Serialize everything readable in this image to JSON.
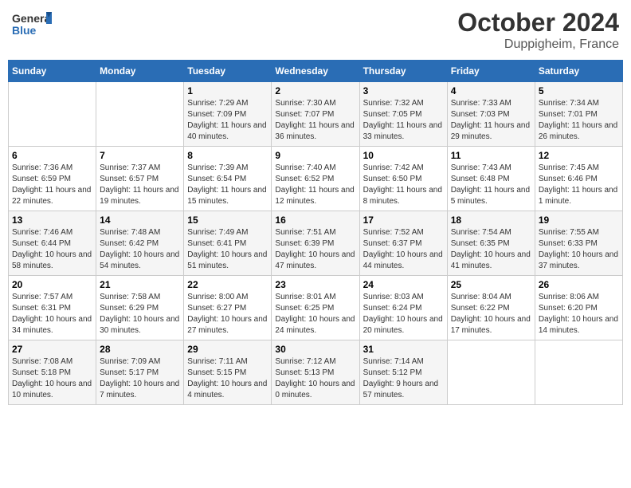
{
  "header": {
    "logo_general": "General",
    "logo_blue": "Blue",
    "month": "October 2024",
    "location": "Duppigheim, France"
  },
  "calendar": {
    "days_of_week": [
      "Sunday",
      "Monday",
      "Tuesday",
      "Wednesday",
      "Thursday",
      "Friday",
      "Saturday"
    ],
    "weeks": [
      [
        {
          "day": null,
          "sunrise": null,
          "sunset": null,
          "daylight": null
        },
        {
          "day": null,
          "sunrise": null,
          "sunset": null,
          "daylight": null
        },
        {
          "day": 1,
          "sunrise": "Sunrise: 7:29 AM",
          "sunset": "Sunset: 7:09 PM",
          "daylight": "Daylight: 11 hours and 40 minutes."
        },
        {
          "day": 2,
          "sunrise": "Sunrise: 7:30 AM",
          "sunset": "Sunset: 7:07 PM",
          "daylight": "Daylight: 11 hours and 36 minutes."
        },
        {
          "day": 3,
          "sunrise": "Sunrise: 7:32 AM",
          "sunset": "Sunset: 7:05 PM",
          "daylight": "Daylight: 11 hours and 33 minutes."
        },
        {
          "day": 4,
          "sunrise": "Sunrise: 7:33 AM",
          "sunset": "Sunset: 7:03 PM",
          "daylight": "Daylight: 11 hours and 29 minutes."
        },
        {
          "day": 5,
          "sunrise": "Sunrise: 7:34 AM",
          "sunset": "Sunset: 7:01 PM",
          "daylight": "Daylight: 11 hours and 26 minutes."
        }
      ],
      [
        {
          "day": 6,
          "sunrise": "Sunrise: 7:36 AM",
          "sunset": "Sunset: 6:59 PM",
          "daylight": "Daylight: 11 hours and 22 minutes."
        },
        {
          "day": 7,
          "sunrise": "Sunrise: 7:37 AM",
          "sunset": "Sunset: 6:57 PM",
          "daylight": "Daylight: 11 hours and 19 minutes."
        },
        {
          "day": 8,
          "sunrise": "Sunrise: 7:39 AM",
          "sunset": "Sunset: 6:54 PM",
          "daylight": "Daylight: 11 hours and 15 minutes."
        },
        {
          "day": 9,
          "sunrise": "Sunrise: 7:40 AM",
          "sunset": "Sunset: 6:52 PM",
          "daylight": "Daylight: 11 hours and 12 minutes."
        },
        {
          "day": 10,
          "sunrise": "Sunrise: 7:42 AM",
          "sunset": "Sunset: 6:50 PM",
          "daylight": "Daylight: 11 hours and 8 minutes."
        },
        {
          "day": 11,
          "sunrise": "Sunrise: 7:43 AM",
          "sunset": "Sunset: 6:48 PM",
          "daylight": "Daylight: 11 hours and 5 minutes."
        },
        {
          "day": 12,
          "sunrise": "Sunrise: 7:45 AM",
          "sunset": "Sunset: 6:46 PM",
          "daylight": "Daylight: 11 hours and 1 minute."
        }
      ],
      [
        {
          "day": 13,
          "sunrise": "Sunrise: 7:46 AM",
          "sunset": "Sunset: 6:44 PM",
          "daylight": "Daylight: 10 hours and 58 minutes."
        },
        {
          "day": 14,
          "sunrise": "Sunrise: 7:48 AM",
          "sunset": "Sunset: 6:42 PM",
          "daylight": "Daylight: 10 hours and 54 minutes."
        },
        {
          "day": 15,
          "sunrise": "Sunrise: 7:49 AM",
          "sunset": "Sunset: 6:41 PM",
          "daylight": "Daylight: 10 hours and 51 minutes."
        },
        {
          "day": 16,
          "sunrise": "Sunrise: 7:51 AM",
          "sunset": "Sunset: 6:39 PM",
          "daylight": "Daylight: 10 hours and 47 minutes."
        },
        {
          "day": 17,
          "sunrise": "Sunrise: 7:52 AM",
          "sunset": "Sunset: 6:37 PM",
          "daylight": "Daylight: 10 hours and 44 minutes."
        },
        {
          "day": 18,
          "sunrise": "Sunrise: 7:54 AM",
          "sunset": "Sunset: 6:35 PM",
          "daylight": "Daylight: 10 hours and 41 minutes."
        },
        {
          "day": 19,
          "sunrise": "Sunrise: 7:55 AM",
          "sunset": "Sunset: 6:33 PM",
          "daylight": "Daylight: 10 hours and 37 minutes."
        }
      ],
      [
        {
          "day": 20,
          "sunrise": "Sunrise: 7:57 AM",
          "sunset": "Sunset: 6:31 PM",
          "daylight": "Daylight: 10 hours and 34 minutes."
        },
        {
          "day": 21,
          "sunrise": "Sunrise: 7:58 AM",
          "sunset": "Sunset: 6:29 PM",
          "daylight": "Daylight: 10 hours and 30 minutes."
        },
        {
          "day": 22,
          "sunrise": "Sunrise: 8:00 AM",
          "sunset": "Sunset: 6:27 PM",
          "daylight": "Daylight: 10 hours and 27 minutes."
        },
        {
          "day": 23,
          "sunrise": "Sunrise: 8:01 AM",
          "sunset": "Sunset: 6:25 PM",
          "daylight": "Daylight: 10 hours and 24 minutes."
        },
        {
          "day": 24,
          "sunrise": "Sunrise: 8:03 AM",
          "sunset": "Sunset: 6:24 PM",
          "daylight": "Daylight: 10 hours and 20 minutes."
        },
        {
          "day": 25,
          "sunrise": "Sunrise: 8:04 AM",
          "sunset": "Sunset: 6:22 PM",
          "daylight": "Daylight: 10 hours and 17 minutes."
        },
        {
          "day": 26,
          "sunrise": "Sunrise: 8:06 AM",
          "sunset": "Sunset: 6:20 PM",
          "daylight": "Daylight: 10 hours and 14 minutes."
        }
      ],
      [
        {
          "day": 27,
          "sunrise": "Sunrise: 7:08 AM",
          "sunset": "Sunset: 5:18 PM",
          "daylight": "Daylight: 10 hours and 10 minutes."
        },
        {
          "day": 28,
          "sunrise": "Sunrise: 7:09 AM",
          "sunset": "Sunset: 5:17 PM",
          "daylight": "Daylight: 10 hours and 7 minutes."
        },
        {
          "day": 29,
          "sunrise": "Sunrise: 7:11 AM",
          "sunset": "Sunset: 5:15 PM",
          "daylight": "Daylight: 10 hours and 4 minutes."
        },
        {
          "day": 30,
          "sunrise": "Sunrise: 7:12 AM",
          "sunset": "Sunset: 5:13 PM",
          "daylight": "Daylight: 10 hours and 0 minutes."
        },
        {
          "day": 31,
          "sunrise": "Sunrise: 7:14 AM",
          "sunset": "Sunset: 5:12 PM",
          "daylight": "Daylight: 9 hours and 57 minutes."
        },
        {
          "day": null,
          "sunrise": null,
          "sunset": null,
          "daylight": null
        },
        {
          "day": null,
          "sunrise": null,
          "sunset": null,
          "daylight": null
        }
      ]
    ]
  }
}
